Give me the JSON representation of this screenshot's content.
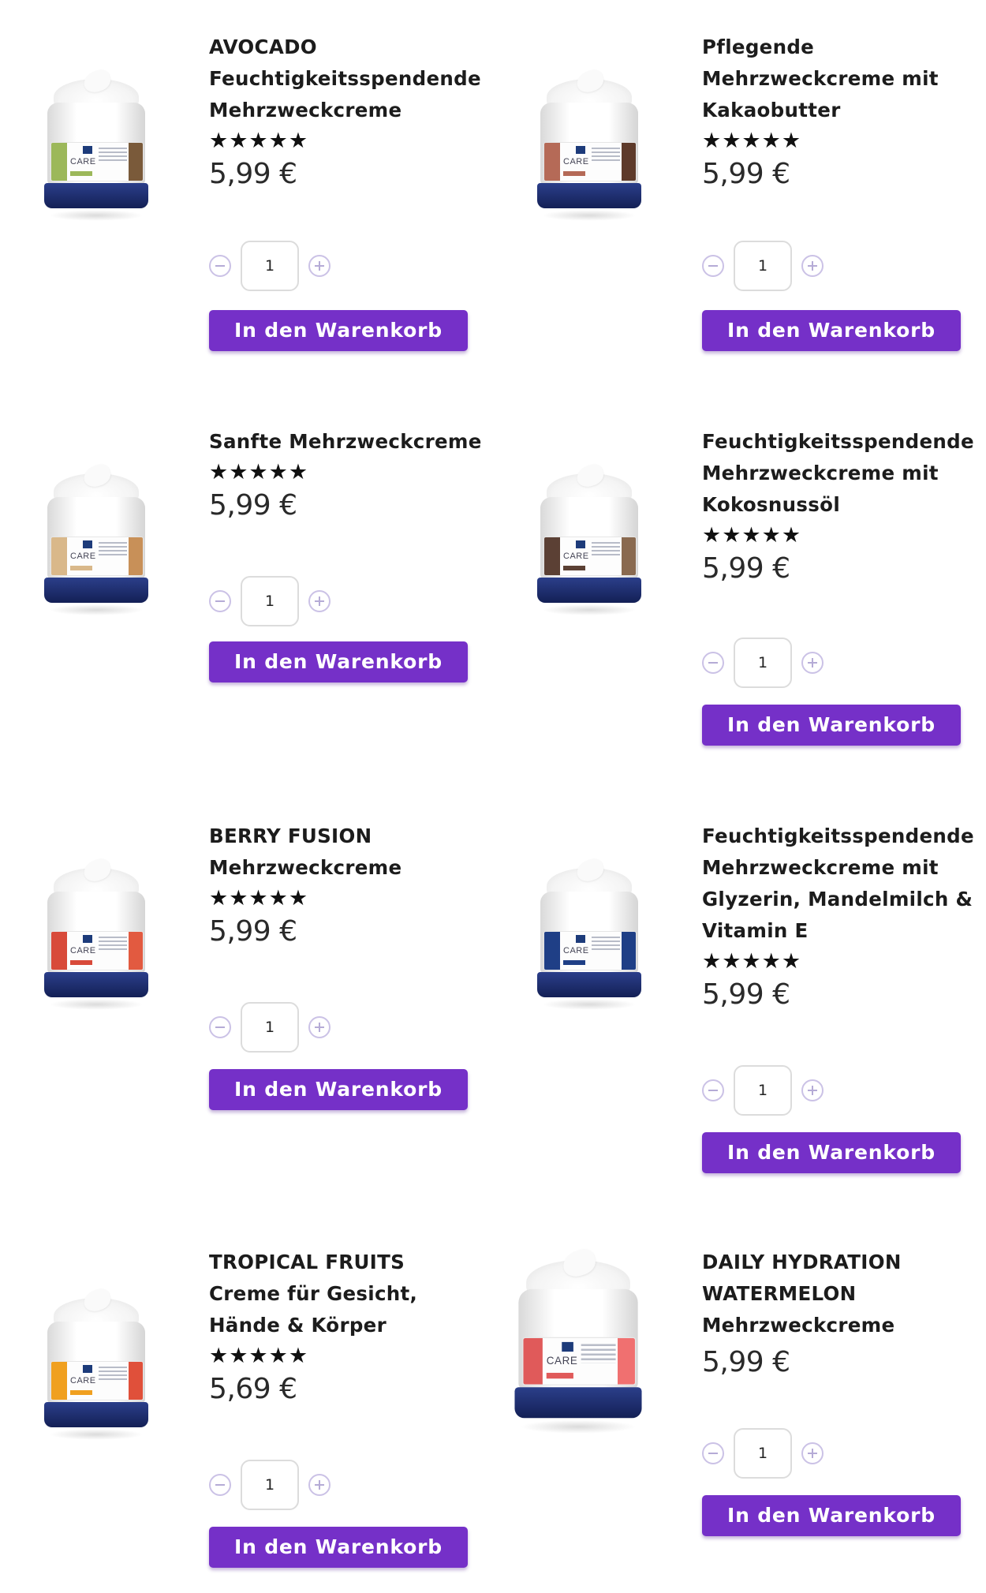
{
  "products": [
    {
      "title_lines": [
        "AVOCADO",
        "Feuchtigkeitsspendende",
        "Mehrzweckcreme"
      ],
      "rating": "★★★★★",
      "price": "5,99 €",
      "quantity": "1",
      "cart_label": "In den Warenkorb",
      "image": "avocado-cream-jar",
      "accent_left": "#9cb85a",
      "accent_right": "#7a5a3a"
    },
    {
      "title_lines": [
        "Pflegende",
        "Mehrzweckcreme mit",
        "Kakaobutter"
      ],
      "rating": "★★★★★",
      "price": "5,99 €",
      "quantity": "1",
      "cart_label": "In den Warenkorb",
      "image": "cocoa-butter-cream-jar",
      "accent_left": "#b56a57",
      "accent_right": "#5e3a2a"
    },
    {
      "title_lines": [
        "Sanfte Mehrzweckcreme"
      ],
      "rating": "★★★★★",
      "price": "5,99 €",
      "quantity": "1",
      "cart_label": "In den Warenkorb",
      "image": "gentle-cream-jar",
      "accent_left": "#d9b88a",
      "accent_right": "#c89058"
    },
    {
      "title_lines": [
        "Feuchtigkeitsspendende",
        "Mehrzweckcreme mit",
        "Kokosnussöl"
      ],
      "rating": "★★★★★",
      "price": "5,99 €",
      "quantity": "1",
      "cart_label": "In den Warenkorb",
      "image": "coconut-oil-cream-jar",
      "accent_left": "#5b4034",
      "accent_right": "#8a6a50"
    },
    {
      "title_lines": [
        "BERRY FUSION",
        "Mehrzweckcreme"
      ],
      "rating": "★★★★★",
      "price": "5,99 €",
      "quantity": "1",
      "cart_label": "In den Warenkorb",
      "image": "berry-fusion-cream-jar",
      "accent_left": "#d84a3a",
      "accent_right": "#e25a40"
    },
    {
      "title_lines": [
        "Feuchtigkeitsspendende",
        "Mehrzweckcreme mit",
        "Glyzerin, Mandelmilch &",
        "Vitamin E"
      ],
      "rating": "★★★★★",
      "price": "5,99 €",
      "quantity": "1",
      "cart_label": "In den Warenkorb",
      "image": "almond-milk-cream-jar",
      "accent_left": "#1f3f86",
      "accent_right": "#1f3f86"
    },
    {
      "title_lines": [
        "TROPICAL FRUITS",
        "Creme für Gesicht,",
        "Hände & Körper"
      ],
      "rating": "★★★★★",
      "price": "5,69 €",
      "quantity": "1",
      "cart_label": "In den Warenkorb",
      "image": "tropical-fruits-cream-jar",
      "accent_left": "#f0a020",
      "accent_right": "#e0503a"
    },
    {
      "title_lines": [
        "DAILY HYDRATION",
        "WATERMELON",
        "Mehrzweckcreme"
      ],
      "rating": "",
      "price": "5,99 €",
      "quantity": "1",
      "cart_label": "In den Warenkorb",
      "image": "watermelon-cream-jar",
      "accent_left": "#e05a5a",
      "accent_right": "#f07070"
    }
  ]
}
